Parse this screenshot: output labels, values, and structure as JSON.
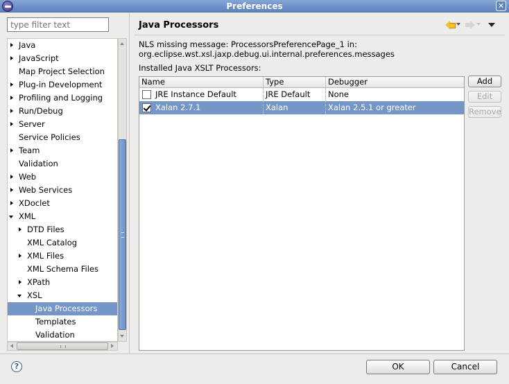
{
  "window": {
    "title": "Preferences"
  },
  "filter": {
    "placeholder": "type filter text"
  },
  "tree": {
    "items": [
      {
        "label": "Java",
        "arrow": "collapsed",
        "level": 0
      },
      {
        "label": "JavaScript",
        "arrow": "collapsed",
        "level": 0
      },
      {
        "label": "Map Project Selection",
        "arrow": "none",
        "level": 0
      },
      {
        "label": "Plug-in Development",
        "arrow": "collapsed",
        "level": 0
      },
      {
        "label": "Profiling and Logging",
        "arrow": "collapsed",
        "level": 0
      },
      {
        "label": "Run/Debug",
        "arrow": "collapsed",
        "level": 0
      },
      {
        "label": "Server",
        "arrow": "collapsed",
        "level": 0
      },
      {
        "label": "Service Policies",
        "arrow": "none",
        "level": 0
      },
      {
        "label": "Team",
        "arrow": "collapsed",
        "level": 0
      },
      {
        "label": "Validation",
        "arrow": "none",
        "level": 0
      },
      {
        "label": "Web",
        "arrow": "collapsed",
        "level": 0
      },
      {
        "label": "Web Services",
        "arrow": "collapsed",
        "level": 0
      },
      {
        "label": "XDoclet",
        "arrow": "collapsed",
        "level": 0
      },
      {
        "label": "XML",
        "arrow": "expanded",
        "level": 0
      },
      {
        "label": "DTD Files",
        "arrow": "collapsed",
        "level": 1
      },
      {
        "label": "XML Catalog",
        "arrow": "none",
        "level": 1
      },
      {
        "label": "XML Files",
        "arrow": "collapsed",
        "level": 1
      },
      {
        "label": "XML Schema Files",
        "arrow": "none",
        "level": 1
      },
      {
        "label": "XPath",
        "arrow": "collapsed",
        "level": 1
      },
      {
        "label": "XSL",
        "arrow": "expanded",
        "level": 1
      },
      {
        "label": "Java Processors",
        "arrow": "none",
        "level": 2,
        "selected": true
      },
      {
        "label": "Templates",
        "arrow": "none",
        "level": 2
      },
      {
        "label": "Validation",
        "arrow": "none",
        "level": 2
      }
    ]
  },
  "page": {
    "title": "Java Processors",
    "message_line1": "NLS missing message: ProcessorsPreferencePage_1 in:",
    "message_line2": "org.eclipse.wst.xsl.jaxp.debug.ui.internal.preferences.messages",
    "installed_label": "Installed Java XSLT Processors:"
  },
  "table": {
    "columns": [
      "Name",
      "Type",
      "Debugger"
    ],
    "rows": [
      {
        "checked": false,
        "name": "JRE Instance Default",
        "type": "JRE Default",
        "debugger": "None",
        "selected": false
      },
      {
        "checked": true,
        "name": "Xalan 2.7.1",
        "type": "Xalan",
        "debugger": "Xalan 2.5.1 or greater",
        "selected": true
      }
    ]
  },
  "buttons": {
    "add": "Add",
    "edit": "Edit",
    "remove": "Remove"
  },
  "dialog": {
    "ok": "OK",
    "cancel": "Cancel",
    "help": "?"
  },
  "colors": {
    "selection": "#7596c6",
    "titlebar": "#6f92c8",
    "background": "#edeceb"
  },
  "icons": {
    "back": "back-arrow-icon",
    "forward": "forward-arrow-icon",
    "menu": "view-menu-icon",
    "help": "help-icon"
  }
}
